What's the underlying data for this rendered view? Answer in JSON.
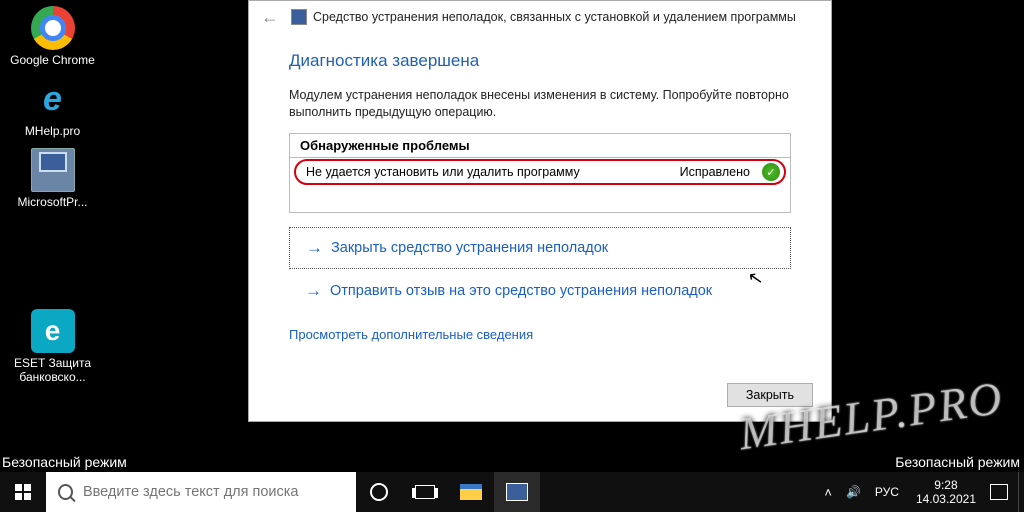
{
  "desktop": {
    "icons": [
      {
        "label": "Google Chrome"
      },
      {
        "label": "MHelp.pro"
      },
      {
        "label": "MicrosoftPr..."
      },
      {
        "label": "ESET Защита банковско..."
      }
    ],
    "safe_mode_label": "Безопасный режим"
  },
  "dialog": {
    "title": "Средство устранения неполадок, связанных с установкой и удалением программы",
    "heading": "Диагностика завершена",
    "description": "Модулем устранения неполадок внесены изменения в систему. Попробуйте повторно выполнить предыдущую операцию.",
    "problems_header": "Обнаруженные проблемы",
    "problem_row": {
      "text": "Не удается установить или удалить программу",
      "status": "Исправлено"
    },
    "action_close": "Закрыть средство устранения неполадок",
    "action_feedback": "Отправить отзыв на это средство устранения неполадок",
    "more_info": "Просмотреть дополнительные сведения",
    "close_btn": "Закрыть"
  },
  "taskbar": {
    "search_placeholder": "Введите здесь текст для поиска",
    "lang": "РУС",
    "time": "9:28",
    "date": "14.03.2021"
  },
  "watermark": "MHELP.PRO"
}
